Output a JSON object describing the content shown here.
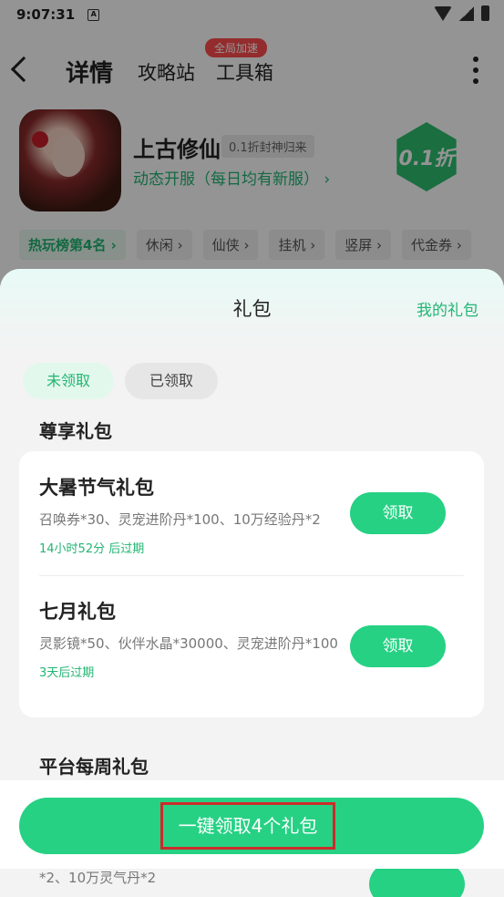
{
  "status_bar": {
    "time": "9:07:31",
    "notification_glyph": "A"
  },
  "nav": {
    "title": "详情",
    "tabs": [
      "攻略站",
      "工具箱"
    ],
    "badge": "全局加速"
  },
  "game": {
    "name": "上古修仙",
    "tag": "0.1折封神归来",
    "server": "动态开服（每日均有新服）",
    "discount": "0.1折",
    "chips": [
      "热玩榜第4名",
      "休闲",
      "仙侠",
      "挂机",
      "竖屏",
      "代金券"
    ]
  },
  "sheet": {
    "title": "礼包",
    "my_gifts": "我的礼包",
    "tabs": {
      "unclaimed": "未领取",
      "claimed": "已领取"
    },
    "sections": {
      "exclusive": "尊享礼包",
      "weekly": "平台每周礼包"
    },
    "gifts": [
      {
        "name": "大暑节气礼包",
        "desc": "召唤券*30、灵宠进阶丹*100、10万经验丹*2",
        "expire": "14小时52分 后过期",
        "button": "领取"
      },
      {
        "name": "七月礼包",
        "desc": "灵影镜*50、伙伴水晶*30000、灵宠进阶丹*100",
        "expire": "3天后过期",
        "button": "领取"
      }
    ],
    "partial_desc": "*2、10万灵气丹*2",
    "bulk_claim": "一键领取4个礼包"
  },
  "colors": {
    "accent": "#26d184",
    "accent_text": "#22b573",
    "badge": "#ff4d4f",
    "highlight_border": "#cc2b2b"
  }
}
